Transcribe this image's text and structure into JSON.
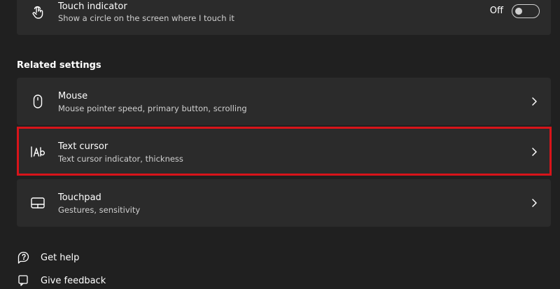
{
  "touch_indicator": {
    "title": "Touch indicator",
    "subtitle": "Show a circle on the screen where I touch it",
    "toggle_state": "Off",
    "icon": "touch-hand-icon"
  },
  "related_settings": {
    "heading": "Related settings",
    "items": [
      {
        "title": "Mouse",
        "subtitle": "Mouse pointer speed, primary button, scrolling",
        "icon": "mouse-icon"
      },
      {
        "title": "Text cursor",
        "subtitle": "Text cursor indicator, thickness",
        "icon": "text-cursor-icon",
        "highlighted": true
      },
      {
        "title": "Touchpad",
        "subtitle": "Gestures, sensitivity",
        "icon": "touchpad-icon"
      }
    ]
  },
  "footer": {
    "get_help": "Get help",
    "give_feedback": "Give feedback"
  },
  "colors": {
    "background": "#202020",
    "card": "#2b2b2b",
    "highlight": "#d8141a",
    "subtext": "#cfcfcf"
  }
}
